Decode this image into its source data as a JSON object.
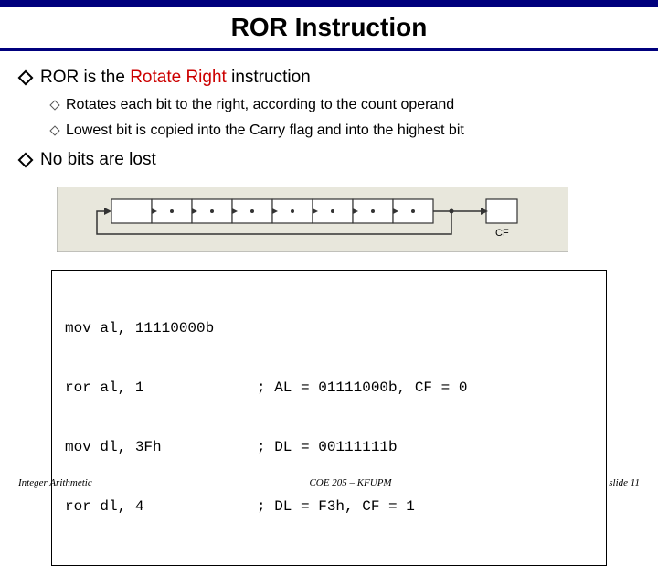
{
  "title": "ROR Instruction",
  "bullets": {
    "main1_pre": "ROR is the ",
    "main1_red": "Rotate Right",
    "main1_post": " instruction",
    "sub1": "Rotates each bit to the right, according to the count operand",
    "sub2": "Lowest bit is copied into the Carry flag and into the highest bit",
    "main2": "No bits are lost"
  },
  "diagram": {
    "cf_label": "CF"
  },
  "code": {
    "l1_left": "mov al, 11110000b",
    "l1_right": "",
    "l2_left": "ror al, 1",
    "l2_right": "; AL = 01111000b, CF = 0",
    "l3_left": "mov dl, 3Fh",
    "l3_right": "; DL = 00111111b",
    "l4_left": "ror dl, 4",
    "l4_right": "; DL = F3h, CF = 1"
  },
  "footer": {
    "left": "Integer Arithmetic",
    "center": "COE 205 – KFUPM",
    "right": "slide 11"
  }
}
